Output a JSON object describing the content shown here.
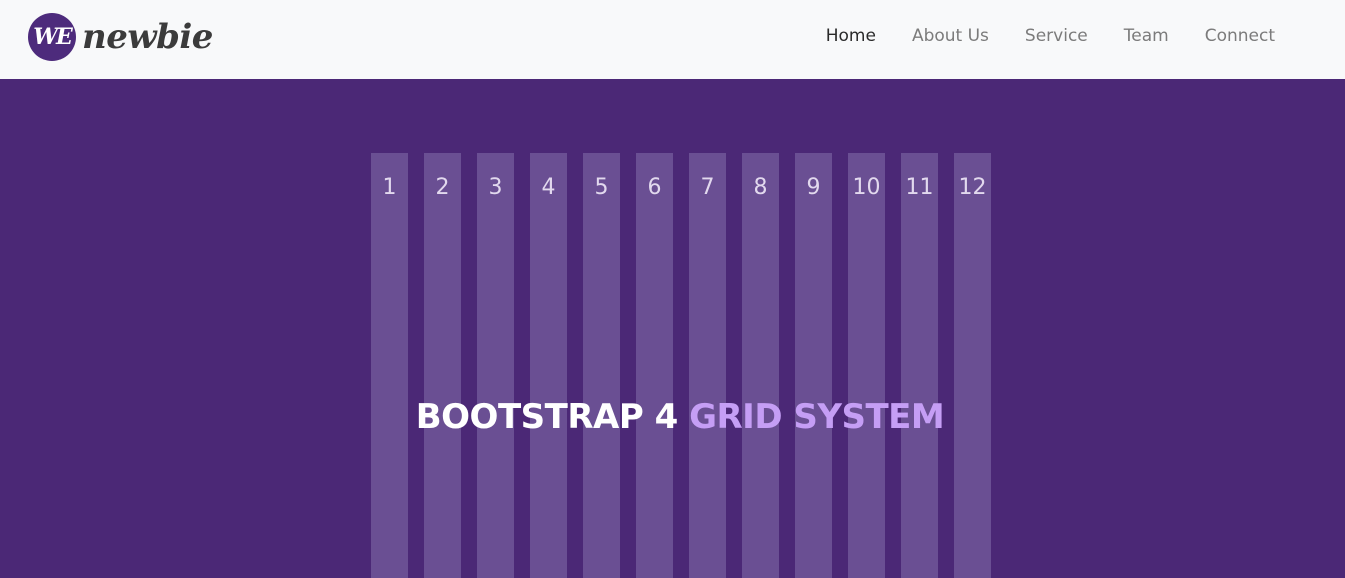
{
  "brand": {
    "logo_mark": "WE",
    "name": "newbie"
  },
  "nav": {
    "items": [
      {
        "label": "Home",
        "active": true
      },
      {
        "label": "About Us",
        "active": false
      },
      {
        "label": "Service",
        "active": false
      },
      {
        "label": "Team",
        "active": false
      },
      {
        "label": "Connect",
        "active": false
      }
    ]
  },
  "hero": {
    "columns": [
      "1",
      "2",
      "3",
      "4",
      "5",
      "6",
      "7",
      "8",
      "9",
      "10",
      "11",
      "12"
    ],
    "title_part1": "BOOTSTRAP 4",
    "title_part2": "GRID SYSTEM"
  },
  "colors": {
    "nav_bg": "#f8f9fa",
    "hero_bg": "#4b2876",
    "column": "#6a4f93",
    "accent": "#c59ef5",
    "brand": "#4d2b7c"
  }
}
